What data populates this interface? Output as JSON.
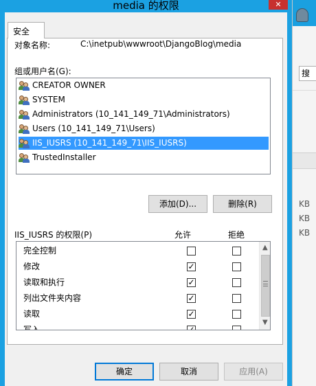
{
  "window": {
    "title": "media 的权限",
    "close_glyph": "✕"
  },
  "tabs": [
    {
      "label": "安全"
    }
  ],
  "object": {
    "label": "对象名称:",
    "value": "C:\\inetpub\\wwwroot\\DjangoBlog\\media"
  },
  "groups": {
    "label": "组或用户名(G):",
    "items": [
      {
        "name": "CREATOR OWNER",
        "selected": false,
        "icon": "users-icon"
      },
      {
        "name": "SYSTEM",
        "selected": false,
        "icon": "users-icon"
      },
      {
        "name": "Administrators (10_141_149_71\\Administrators)",
        "selected": false,
        "icon": "users-icon"
      },
      {
        "name": "Users (10_141_149_71\\Users)",
        "selected": false,
        "icon": "users-icon"
      },
      {
        "name": "IIS_IUSRS (10_141_149_71\\IIS_IUSRS)",
        "selected": true,
        "icon": "users-icon"
      },
      {
        "name": "TrustedInstaller",
        "selected": false,
        "icon": "users-icon"
      }
    ],
    "add_label": "添加(D)...",
    "remove_label": "删除(R)"
  },
  "permissions": {
    "title": "IIS_IUSRS 的权限(P)",
    "allow_header": "允许",
    "deny_header": "拒绝",
    "rows": [
      {
        "name": "完全控制",
        "allow": false,
        "deny": false
      },
      {
        "name": "修改",
        "allow": true,
        "deny": false
      },
      {
        "name": "读取和执行",
        "allow": true,
        "deny": false
      },
      {
        "name": "列出文件夹内容",
        "allow": true,
        "deny": false
      },
      {
        "name": "读取",
        "allow": true,
        "deny": false
      },
      {
        "name": "写入",
        "allow": true,
        "deny": false
      }
    ]
  },
  "footer": {
    "ok_label": "确定",
    "cancel_label": "取消",
    "apply_label": "应用(A)"
  },
  "background": {
    "search_label": "搜",
    "kb_labels": [
      "KB",
      "KB",
      "KB"
    ]
  },
  "colors": {
    "title_bar": "#1ba1e2",
    "selection": "#3399ff",
    "close_button": "#c7302e"
  }
}
